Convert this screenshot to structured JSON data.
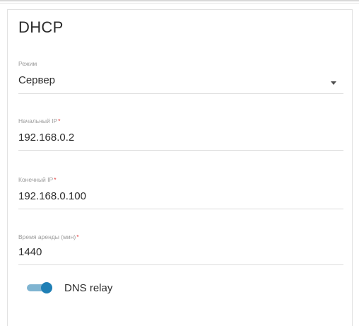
{
  "section": {
    "title": "DHCP"
  },
  "mode": {
    "label": "Режим",
    "value": "Сервер",
    "icon": "chevron-down-icon"
  },
  "start_ip": {
    "label": "Начальный IP",
    "required_mark": "*",
    "value": "192.168.0.2"
  },
  "end_ip": {
    "label": "Конечный IP",
    "required_mark": "*",
    "value": "192.168.0.100"
  },
  "lease_time": {
    "label": "Время аренды (мин)",
    "required_mark": "*",
    "value": "1440"
  },
  "dns_relay": {
    "label": "DNS relay",
    "enabled": true,
    "accent_color": "#1f7fb5"
  }
}
